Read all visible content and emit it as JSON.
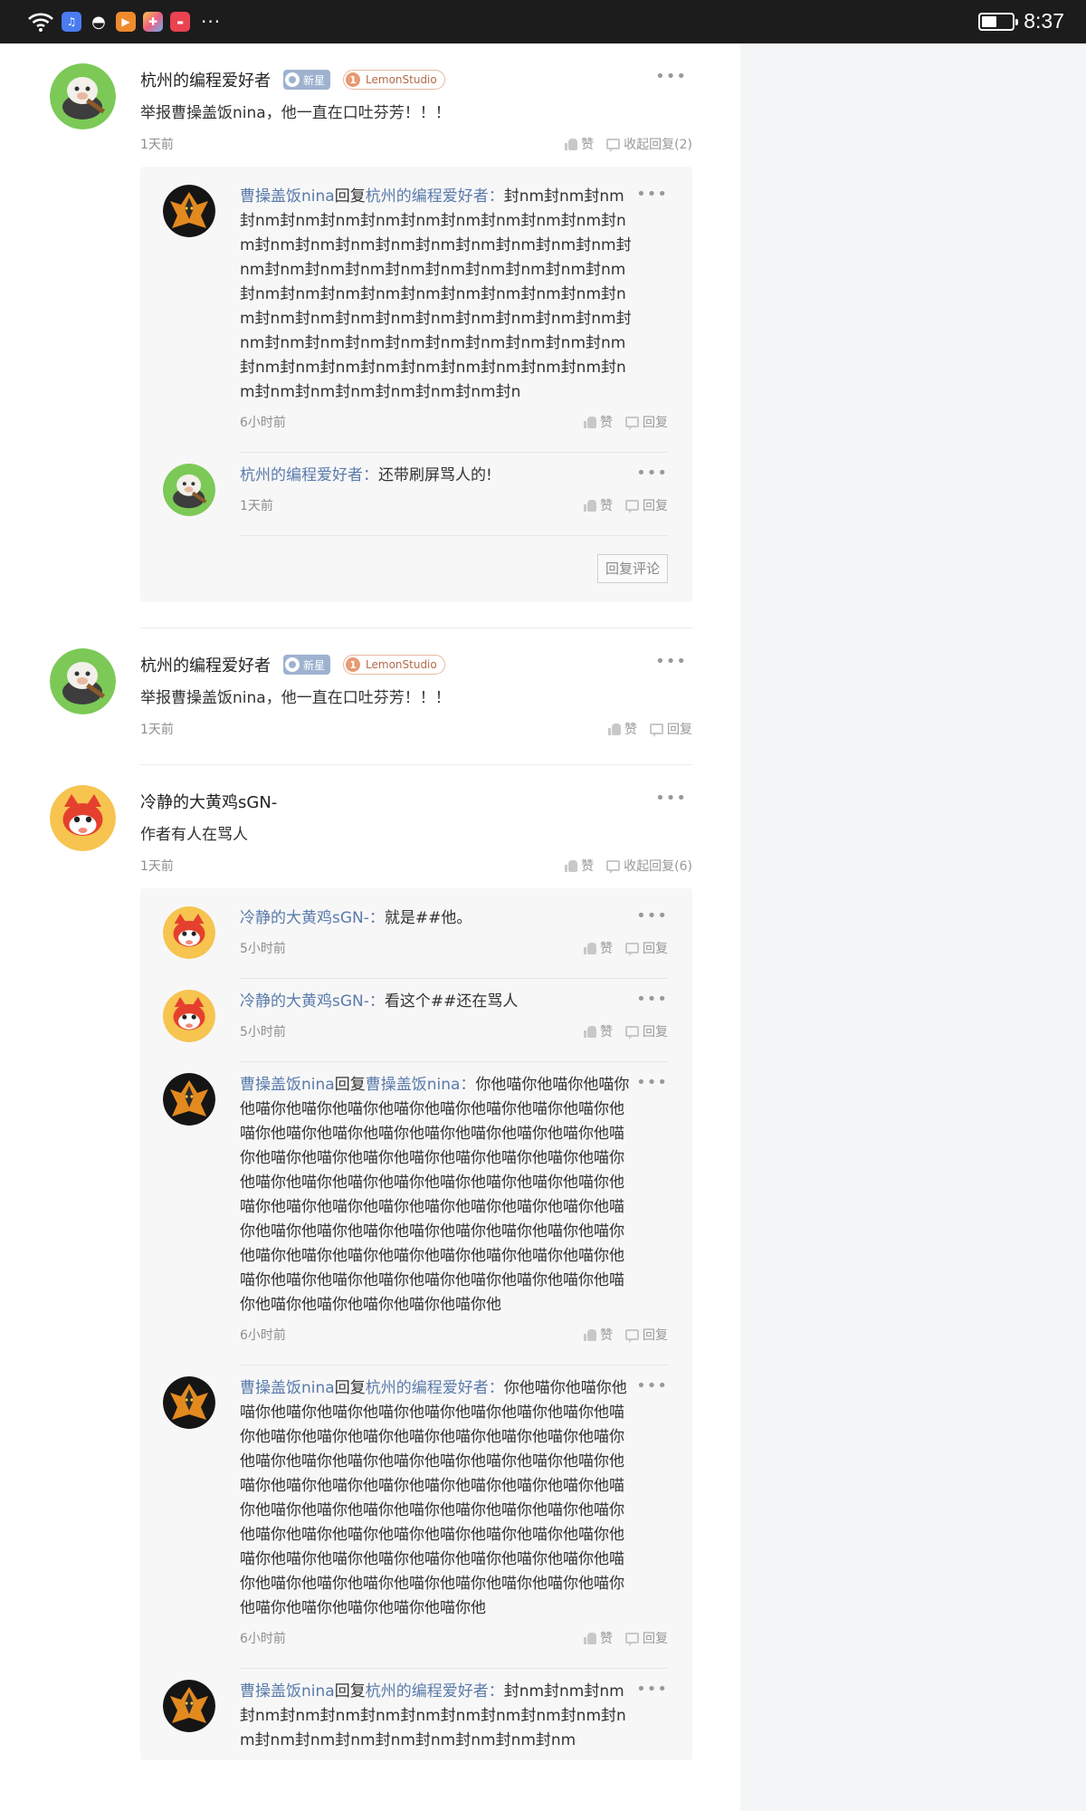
{
  "status_bar": {
    "time": "8:37",
    "battery_level": 0.45,
    "app_icons": [
      "music-app",
      "qq-app",
      "video-app",
      "photo-app",
      "shop-app"
    ],
    "more": "···"
  },
  "colors": {
    "link_blue": "#5a7bab",
    "badge_blue": "#9eb2cf",
    "badge_orange": "#e79a74"
  },
  "comments": [
    {
      "user": "杭州的编程爱好者",
      "badge_new": "新星",
      "badge_studio_num": "1",
      "badge_studio": "LemonStudio",
      "text": "举报曹操盖饭nina，他一直在口吐芬芳！！！",
      "time": "1天前",
      "like": "赞",
      "toggle": "收起回复(2)",
      "replies": [
        {
          "user": "曹操盖饭nina",
          "reply_word": "回复",
          "target": "杭州的编程爱好者",
          "colon": "：",
          "text": "封nm封nm封nm封nm封nm封nm封nm封nm封nm封nm封nm封nm封nm封nm封nm封nm封nm封nm封nm封nm封nm封nm封nm封nm封nm封nm封nm封nm封nm封nm封nm封nm封nm封nm封nm封nm封nm封nm封nm封nm封nm封nm封nm封nm封nm封nm封nm封nm封nm封nm封nm封nm封nm封nm封nm封nm封nm封nm封nm封nm封nm封nm封nm封nm封nm封nm封nm封nm封nm封nm封nm封nm封nm封nm封nm封nm封nm封n",
          "time": "6小时前",
          "like": "赞",
          "reply": "回复"
        },
        {
          "user": "杭州的编程爱好者",
          "reply_word": "",
          "target": "",
          "colon": "：",
          "text": "还带刷屏骂人的!",
          "time": "1天前",
          "like": "赞",
          "reply": "回复"
        }
      ],
      "reply_comment_button": "回复评论"
    },
    {
      "user": "杭州的编程爱好者",
      "badge_new": "新星",
      "badge_studio_num": "1",
      "badge_studio": "LemonStudio",
      "text": "举报曹操盖饭nina，他一直在口吐芬芳！！！",
      "time": "1天前",
      "like": "赞",
      "reply": "回复"
    },
    {
      "user": "冷静的大黄鸡sGN-",
      "text": "作者有人在骂人",
      "time": "1天前",
      "like": "赞",
      "toggle": "收起回复(6)",
      "replies": [
        {
          "user": "冷静的大黄鸡sGN-",
          "reply_word": "",
          "target": "",
          "colon": "：",
          "text": "就是##他。",
          "time": "5小时前",
          "like": "赞",
          "reply": "回复"
        },
        {
          "user": "冷静的大黄鸡sGN-",
          "reply_word": "",
          "target": "",
          "colon": "：",
          "text": "看这个##还在骂人",
          "time": "5小时前",
          "like": "赞",
          "reply": "回复"
        },
        {
          "user": "曹操盖饭nina",
          "reply_word": "回复",
          "target": "曹操盖饭nina",
          "colon": "：",
          "text": "你他喵你他喵你他喵你他喵你他喵你他喵你他喵你他喵你他喵你他喵你他喵你他喵你他喵你他喵你他喵你他喵你他喵你他喵你他喵你他喵你他喵你他喵你他喵你他喵你他喵你他喵你他喵你他喵你他喵你他喵你他喵你他喵你他喵你他喵你他喵你他喵你他喵你他喵你他喵你他喵你他喵你他喵你他喵你他喵你他喵你他喵你他喵你他喵你他喵你他喵你他喵你他喵你他喵你他喵你他喵你他喵你他喵你他喵你他喵你他喵你他喵你他喵你他喵你他喵你他喵你他喵你他喵你他喵你他喵你他喵你他喵你他喵你他喵你他喵你他喵你他",
          "time": "6小时前",
          "like": "赞",
          "reply": "回复"
        },
        {
          "user": "曹操盖饭nina",
          "reply_word": "回复",
          "target": "杭州的编程爱好者",
          "colon": "：",
          "text": "你他喵你他喵你他喵你他喵你他喵你他喵你他喵你他喵你他喵你他喵你他喵你他喵你他喵你他喵你他喵你他喵你他喵你他喵你他喵你他喵你他喵你他喵你他喵你他喵你他喵你他喵你他喵你他喵你他喵你他喵你他喵你他喵你他喵你他喵你他喵你他喵你他喵你他喵你他喵你他喵你他喵你他喵你他喵你他喵你他喵你他喵你他喵你他喵你他喵你他喵你他喵你他喵你他喵你他喵你他喵你他喵你他喵你他喵你他喵你他喵你他喵你他喵你他喵你他喵你他喵你他喵你他喵你他喵你他喵你他喵你他喵你他喵你他喵你他喵你他",
          "time": "6小时前",
          "like": "赞",
          "reply": "回复"
        },
        {
          "user": "曹操盖饭nina",
          "reply_word": "回复",
          "target": "杭州的编程爱好者",
          "colon": "：",
          "text": "封nm封nm封nm封nm封nm封nm封nm封nm封nm封nm封nm封nm封nm封nm封nm封nm封nm封nm封nm封nm封nm",
          "time": "",
          "like": "",
          "reply": ""
        }
      ]
    }
  ]
}
